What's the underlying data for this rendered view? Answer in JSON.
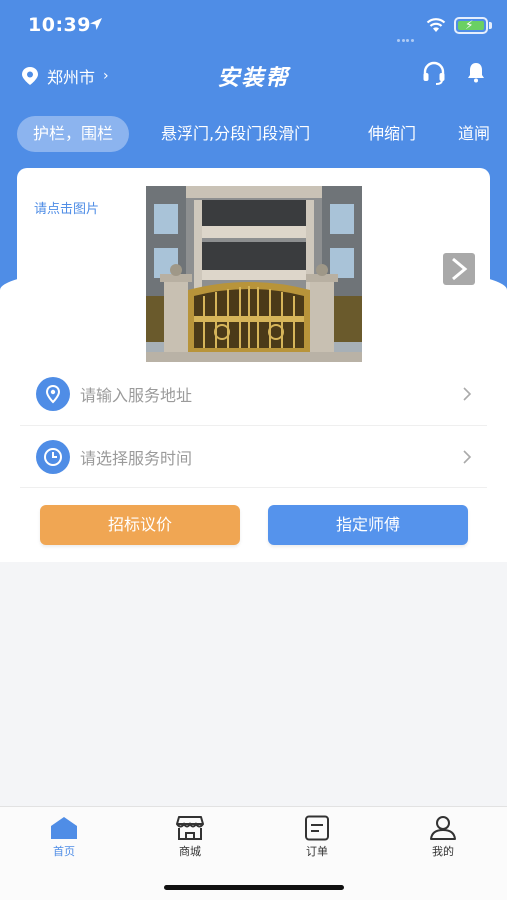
{
  "status_bar": {
    "time": "10:39"
  },
  "nav": {
    "city": "郑州市",
    "title": "安装帮"
  },
  "tabs": [
    {
      "label": "护栏，围栏",
      "active": true
    },
    {
      "label": "悬浮门,分段门段滑门",
      "active": false
    },
    {
      "label": "伸缩门",
      "active": false
    },
    {
      "label": "道闸",
      "active": false
    }
  ],
  "card": {
    "hint": "请点击图片",
    "address_placeholder": "请输入服务地址",
    "time_placeholder": "请选择服务时间",
    "bid_button": "招标议价",
    "assign_button": "指定师傅"
  },
  "tab_bar": [
    {
      "label": "首页",
      "icon": "home-icon",
      "active": true
    },
    {
      "label": "商城",
      "icon": "shop-icon",
      "active": false
    },
    {
      "label": "订单",
      "icon": "order-icon",
      "active": false
    },
    {
      "label": "我的",
      "icon": "profile-icon",
      "active": false
    }
  ],
  "colors": {
    "primary": "#4f8de6",
    "orange": "#f0a653",
    "background": "#f4f5f7"
  }
}
